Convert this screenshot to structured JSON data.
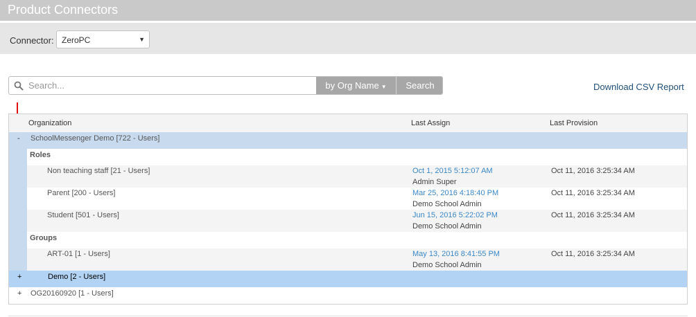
{
  "header": {
    "title": "Product Connectors"
  },
  "connector": {
    "label": "Connector:",
    "selected": "ZeroPC"
  },
  "search": {
    "placeholder": "Search...",
    "by_label": "by Org Name",
    "button_label": "Search",
    "csv_link": "Download CSV Report"
  },
  "table": {
    "columns": [
      "Organization",
      "Last Assign",
      "Last Provision"
    ],
    "org1": {
      "toggle": "-",
      "name": "SchoolMessenger Demo [722 - Users]"
    },
    "roles_label": "Roles",
    "roles": [
      {
        "name": "Non teaching staff [21 - Users]",
        "assign_date": "Oct 1, 2015 5:12:07 AM",
        "assign_by": "Admin Super",
        "provision": "Oct 11, 2016 3:25:34 AM"
      },
      {
        "name": "Parent [200 - Users]",
        "assign_date": "Mar 25, 2016 4:18:40 PM",
        "assign_by": "Demo School Admin",
        "provision": "Oct 11, 2016 3:25:34 AM"
      },
      {
        "name": "Student [501 - Users]",
        "assign_date": "Jun 15, 2016 5:22:02 PM",
        "assign_by": "Demo School Admin",
        "provision": "Oct 11, 2016 3:25:34 AM"
      }
    ],
    "groups_label": "Groups",
    "groups": [
      {
        "name": "ART-01 [1 - Users]",
        "assign_date": "May 13, 2016 8:41:55 PM",
        "assign_by": "Demo School Admin",
        "provision": "Oct 11, 2016 3:25:34 AM"
      }
    ],
    "subgroup": {
      "toggle": "+",
      "name": "Demo [2 - Users]"
    },
    "org2": {
      "toggle": "+",
      "name": "OG20160920 [1 - Users]"
    }
  },
  "colors": {
    "title_bar": "#c9c9c9",
    "connector_bar": "#e6e6e6",
    "org_row": "#c8dbee",
    "selected_row": "#b3d3f5",
    "date_link": "#3a87c8",
    "arrow": "#e01010"
  }
}
